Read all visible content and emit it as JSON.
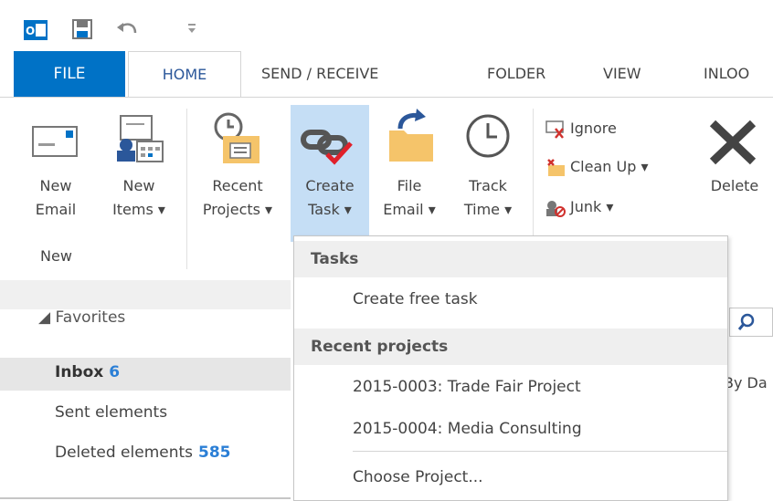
{
  "tabs": {
    "file": "FILE",
    "home": "HOME",
    "send_receive": "SEND / RECEIVE",
    "folder": "FOLDER",
    "view": "VIEW",
    "inloox": "INLOO"
  },
  "ribbon": {
    "new_email": [
      "New",
      "Email"
    ],
    "new_items": [
      "New",
      "Items ▾"
    ],
    "recent_projects": [
      "Recent",
      "Projects ▾"
    ],
    "create_task": [
      "Create",
      "Task ▾"
    ],
    "file_email": [
      "File",
      "Email ▾"
    ],
    "track_time": [
      "Track",
      "Time ▾"
    ],
    "ignore": "Ignore",
    "clean_up": "Clean Up ▾",
    "junk": "Junk ▾",
    "delete": "Delete",
    "group_new": "New"
  },
  "nav": {
    "favorites": "◢ Favorites",
    "inbox": "Inbox",
    "inbox_count": "6",
    "sent": "Sent elements",
    "deleted": "Deleted elements",
    "deleted_count": "585"
  },
  "list": {
    "by_date": "By Da"
  },
  "menu": {
    "tasks_header": "Tasks",
    "create_free_task": "Create free task",
    "recent_header": "Recent projects",
    "project_1": "2015-0003: Trade Fair Project",
    "project_2": "2015-0004: Media Consulting",
    "choose_project": "Choose Project..."
  },
  "colors": {
    "accent": "#0072c6",
    "count": "#2b7fd6",
    "selected_button": "#c5def5"
  }
}
